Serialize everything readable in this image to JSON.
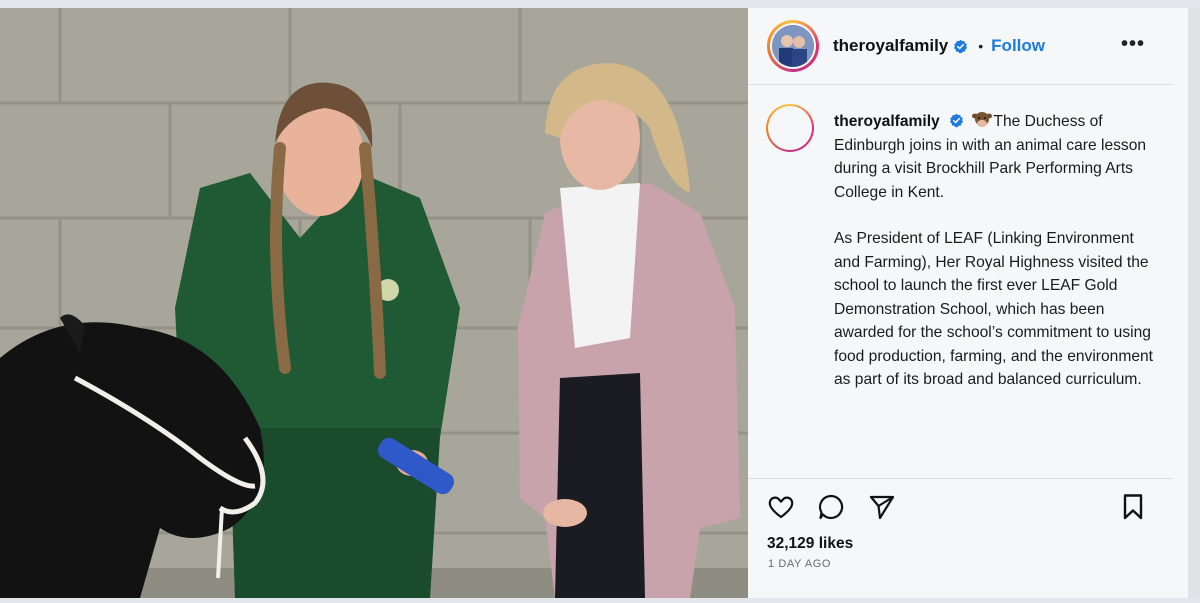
{
  "post": {
    "username": "theroyalfamily",
    "follow_label": "Follow",
    "separator": "•",
    "more_label": "•••",
    "icons": {
      "verified": "verified-badge-icon",
      "like": "heart-icon",
      "comment": "comment-icon",
      "share": "paper-plane-icon",
      "save": "bookmark-icon",
      "caption_emoji": "cow-face-emoji-icon"
    },
    "caption": {
      "username": "theroyalfamily",
      "paragraph1": "The Duchess of Edinburgh joins in with an animal care lesson during a visit Brockhill Park Performing Arts College in Kent.",
      "paragraph2": "As President of LEAF (Linking Environment and Farming), Her Royal Highness visited the school to launch the first ever LEAF Gold Demonstration School, which has been awarded for the school’s commitment to using food production, farming, and the environment as part of its broad and balanced curriculum."
    },
    "likes": "32,129 likes",
    "time_ago": "1 DAY AGO",
    "colors": {
      "link": "#1d7be0",
      "verified": "#1d7be0",
      "text": "#1b1b1b"
    }
  }
}
